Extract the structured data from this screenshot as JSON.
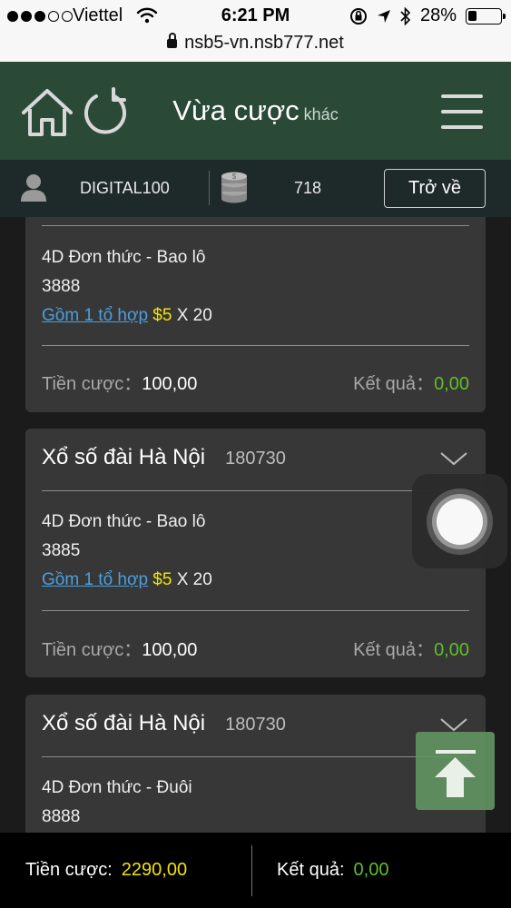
{
  "status_bar": {
    "carrier": "Viettel",
    "time": "6:21 PM",
    "battery": "28%",
    "battery_level": 0.28,
    "url": "nsb5-vn.nsb777.net"
  },
  "header": {
    "title": "Vừa cược",
    "subtitle": "khác"
  },
  "user_bar": {
    "username": "DIGITAL100",
    "balance": "718",
    "back_label": "Trở về"
  },
  "labels": {
    "stake": "Tiền cược",
    "result": "Kết quả",
    "colon": "："
  },
  "bets": [
    {
      "title": "",
      "code": "",
      "type": "4D Đơn thức - Bao lô",
      "number": "3888",
      "combo": "Gồm 1 tổ hợp",
      "amount": "$5",
      "multiplier": "X 20",
      "stake": "100,00",
      "result": "0,00"
    },
    {
      "title": "Xổ số đài Hà Nội",
      "code": "180730",
      "type": "4D Đơn thức - Bao lô",
      "number": "3885",
      "combo": "Gồm 1 tổ hợp",
      "amount": "$5",
      "multiplier": "X 20",
      "stake": "100,00",
      "result": "0,00"
    },
    {
      "title": "Xổ số đài Hà Nội",
      "code": "180730",
      "type": "4D Đơn thức - Đuôi",
      "number": "8888"
    }
  ],
  "summary": {
    "stake_label": "Tiền cược:",
    "stake_total": "2290,00",
    "result_label": "Kết quả:",
    "result_total": "0,00"
  },
  "colors": {
    "header_green": "#2a4a37",
    "user_bar": "#1e2a29",
    "card": "#373737",
    "accent_yellow": "#f2e400",
    "result_green": "#5fbf2a",
    "link_blue": "#4a9fe0"
  }
}
